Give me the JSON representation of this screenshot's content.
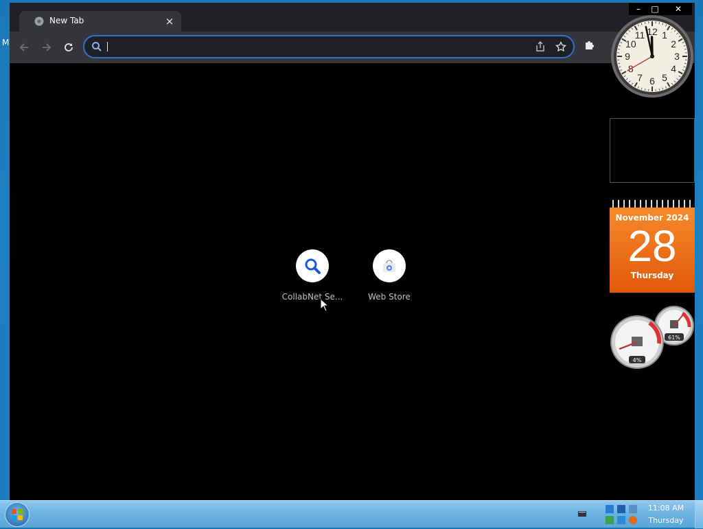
{
  "desktop": {
    "edge_label": "M"
  },
  "browser": {
    "tab_title": "New Tab",
    "tab_close_glyph": "×",
    "window_controls": {
      "minimize": "–",
      "maximize": "□",
      "close": "✕"
    },
    "icons": [
      "back-icon",
      "forward-icon",
      "reload-icon",
      "search-icon",
      "share-icon",
      "star-icon",
      "extensions-icon"
    ],
    "shortcuts": [
      {
        "label": "CollabNet Se...",
        "icon": "search-magnifier-icon"
      },
      {
        "label": "Web Store",
        "icon": "web-store-icon"
      }
    ],
    "accent_color": "#2f6fd6"
  },
  "gadgets": {
    "clock": {
      "hour": 11,
      "minute": 58,
      "second": 40,
      "numerals": [
        "12",
        "1",
        "2",
        "3",
        "4",
        "5",
        "6",
        "7",
        "8",
        "9",
        "10",
        "11"
      ]
    },
    "calendar": {
      "month_year": "November 2024",
      "day": "28",
      "weekday": "Thursday"
    },
    "meters": {
      "cpu": "4%",
      "memory": "61%"
    }
  },
  "taskbar": {
    "time": "11:08 AM",
    "day": "Thursday"
  }
}
